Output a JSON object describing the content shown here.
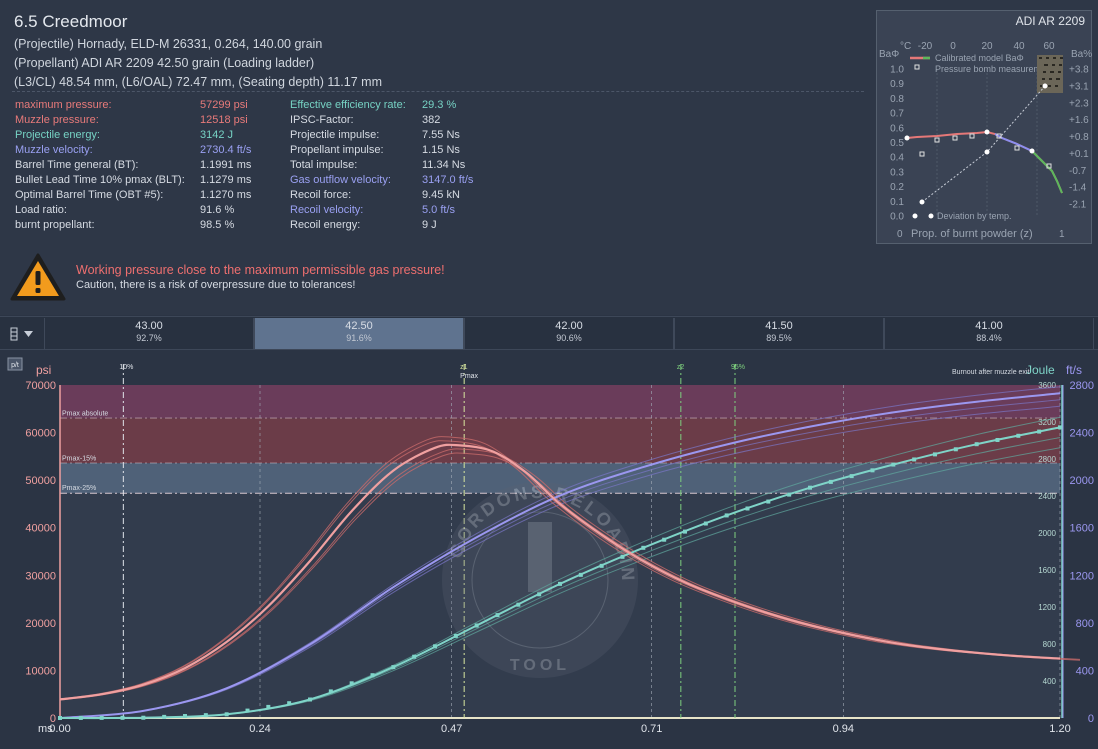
{
  "header": {
    "title": "6.5 Creedmoor",
    "projectile": "(Projectile) Hornady, ELD-M 26331, 0.264, 140.00 grain",
    "propellant": "(Propellant) ADI AR 2209 42.50 grain (Loading ladder)",
    "dims": "(L3/CL) 48.54 mm, (L6/OAL) 72.47 mm, (Seating depth) 11.17 mm"
  },
  "results_left": [
    {
      "label": "maximum pressure:",
      "value": "57299 psi",
      "color": "red"
    },
    {
      "label": "Muzzle pressure:",
      "value": "12518 psi",
      "color": "red"
    },
    {
      "label": "Projectile energy:",
      "value": "3142 J",
      "color": "teal"
    },
    {
      "label": "Muzzle velocity:",
      "value": "2730.4 ft/s",
      "color": "purple"
    },
    {
      "label": "Barrel Time general (BT):",
      "value": "1.1991 ms",
      "color": "white"
    },
    {
      "label": "Bullet Lead Time 10% pmax (BLT):",
      "value": "1.1279 ms",
      "color": "white"
    },
    {
      "label": "Optimal Barrel Time (OBT #5):",
      "value": "1.1270 ms",
      "color": "white"
    },
    {
      "label": "Load ratio:",
      "value": "91.6 %",
      "color": "white"
    },
    {
      "label": "burnt propellant:",
      "value": "98.5 %",
      "color": "white"
    }
  ],
  "results_right": [
    {
      "label": "Effective efficiency rate:",
      "value": "29.3 %",
      "color": "teal"
    },
    {
      "label": "IPSC-Factor:",
      "value": "382",
      "color": "white"
    },
    {
      "label": "Projectile impulse:",
      "value": "7.55 Ns",
      "color": "white"
    },
    {
      "label": "Propellant impulse:",
      "value": "1.15 Ns",
      "color": "white"
    },
    {
      "label": "Total impulse:",
      "value": "11.34 Ns",
      "color": "white"
    },
    {
      "label": "Gas outflow velocity:",
      "value": "3147.0 ft/s",
      "color": "purple"
    },
    {
      "label": "Recoil force:",
      "value": "9.45 kN",
      "color": "white"
    },
    {
      "label": "Recoil velocity:",
      "value": "5.0 ft/s",
      "color": "purple"
    },
    {
      "label": "Recoil energy:",
      "value": "9 J",
      "color": "white"
    }
  ],
  "warning": {
    "icon": "warning-triangle-icon",
    "title": "Working pressure close to the maximum permissible gas pressure!",
    "subtitle": "Caution, there is a risk of overpressure due to tolerances!"
  },
  "inset": {
    "title": "ADI AR 2209",
    "left_label": "BaΦ",
    "right_label": "Ba%",
    "top_label": "°C",
    "top_ticks": [
      "-20",
      "0",
      "20",
      "40",
      "60"
    ],
    "left_ticks": [
      "1.0",
      "0.9",
      "0.8",
      "0.7",
      "0.6",
      "0.5",
      "0.4",
      "0.3",
      "0.2",
      "0.1",
      "0.0"
    ],
    "right_ticks": [
      "+3.8",
      "+3.1",
      "+2.3",
      "+1.6",
      "+0.8",
      "+0.1",
      "-0.7",
      "-1.4",
      "-2.1"
    ],
    "legend_model": "Calibrated model BaΦ",
    "legend_bomb": "Pressure bomb measurement",
    "legend_temp": "Deviation by temp.",
    "xlabel": "Prop. of burnt powder (z)",
    "x_left": "0",
    "x_right": "1"
  },
  "ladder": {
    "menu_icon": "ladder-menu-icon",
    "selected_index": 1,
    "cells": [
      {
        "charge": "43.00",
        "ratio": "92.7%"
      },
      {
        "charge": "42.50",
        "ratio": "91.6%"
      },
      {
        "charge": "42.00",
        "ratio": "90.6%"
      },
      {
        "charge": "41.50",
        "ratio": "89.5%"
      },
      {
        "charge": "41.00",
        "ratio": "88.4%"
      }
    ]
  },
  "chart_data": {
    "type": "line",
    "toggle_label": "p/t",
    "left_unit": "psi",
    "right_units": [
      "Joule",
      "ft/s"
    ],
    "xlabel": "ms",
    "xlim": [
      0.0,
      1.2
    ],
    "x_ticks": [
      "0.00",
      "0.24",
      "0.47",
      "0.71",
      "0.94",
      "1.20"
    ],
    "y_left": [
      0,
      70000
    ],
    "y_left_ticks": [
      "0",
      "10000",
      "20000",
      "30000",
      "40000",
      "50000",
      "60000",
      "70000"
    ],
    "y_joule_ticks": [
      "400",
      "800",
      "1200",
      "1600",
      "2000",
      "2400",
      "2800",
      "3200",
      "3600"
    ],
    "y_fts_ticks": [
      "0",
      "400",
      "800",
      "1200",
      "1600",
      "2000",
      "2400",
      "2800"
    ],
    "bands": [
      {
        "label": "Pmax absolute",
        "from": 63000,
        "to": 70000,
        "color": "#6a3c5a"
      },
      {
        "label": "Pmax-15%",
        "from": 53550,
        "to": 63000,
        "color": "#6b3c48"
      },
      {
        "label": "Pmax-25%",
        "from": 47250,
        "to": 53550,
        "color": "#4f6178"
      }
    ],
    "markers": [
      {
        "label": "10%",
        "x": 0.076
      },
      {
        "label": "z1",
        "sub": "Pmax",
        "x": 0.485
      },
      {
        "label": "z2",
        "x": 0.745
      },
      {
        "label": "95%",
        "x": 0.81
      }
    ],
    "burnout_label": "Burnout after muzzle exit",
    "watermark": {
      "top": "GORDONS RELOADING",
      "bottom": "TOOL"
    },
    "series": [
      {
        "name": "pressure",
        "color": "#f0a0a0",
        "x": [
          0,
          0.05,
          0.1,
          0.15,
          0.2,
          0.25,
          0.3,
          0.35,
          0.4,
          0.45,
          0.48,
          0.52,
          0.56,
          0.6,
          0.65,
          0.7,
          0.75,
          0.8,
          0.85,
          0.9,
          0.95,
          1.0,
          1.05,
          1.1,
          1.15,
          1.2
        ],
        "y": [
          3900,
          5000,
          7000,
          10500,
          16000,
          23500,
          33000,
          43500,
          52000,
          56800,
          57299,
          56000,
          51500,
          45000,
          38500,
          33000,
          28500,
          25000,
          22000,
          19500,
          17500,
          15800,
          14600,
          13700,
          13000,
          12500
        ]
      },
      {
        "name": "velocity",
        "color": "#9b97f0",
        "x": [
          0,
          0.1,
          0.2,
          0.3,
          0.4,
          0.5,
          0.6,
          0.7,
          0.8,
          0.9,
          1.0,
          1.1,
          1.2
        ],
        "y": [
          0,
          60,
          250,
          620,
          1100,
          1520,
          1870,
          2110,
          2300,
          2450,
          2570,
          2660,
          2730
        ]
      },
      {
        "name": "energy",
        "color": "#7fd4c8",
        "x": [
          0,
          0.1,
          0.2,
          0.3,
          0.4,
          0.5,
          0.6,
          0.7,
          0.8,
          0.9,
          1.0,
          1.1,
          1.2
        ],
        "y": [
          0,
          3,
          40,
          200,
          550,
          1000,
          1450,
          1840,
          2190,
          2490,
          2740,
          2960,
          3142
        ]
      }
    ]
  }
}
